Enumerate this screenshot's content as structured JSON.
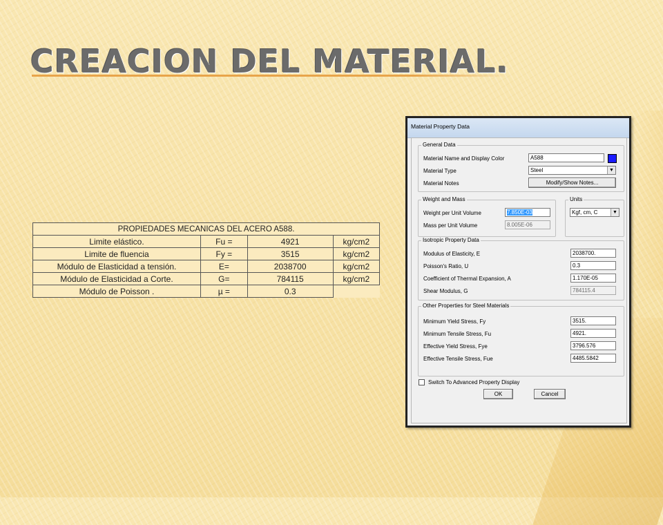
{
  "slide": {
    "title": "CREACION DEL MATERIAL."
  },
  "table": {
    "caption": "PROPIEDADES MECANICAS DEL ACERO A588.",
    "rows": [
      {
        "property": "Limite elástico.",
        "symbol": "Fu  =",
        "value": "4921",
        "unit": "kg/cm2"
      },
      {
        "property": "Limite de fluencia",
        "symbol": "Fy  =",
        "value": "3515",
        "unit": "kg/cm2"
      },
      {
        "property": "Módulo de Elasticidad a tensión.",
        "symbol": "E=",
        "value": "2038700",
        "unit": "kg/cm2"
      },
      {
        "property": "Módulo de Elasticidad a Corte.",
        "symbol": "G=",
        "value": "784115",
        "unit": "kg/cm2"
      },
      {
        "property": "Módulo de Poisson .",
        "symbol": "µ =",
        "value": "0.3",
        "unit": ""
      }
    ]
  },
  "dialog": {
    "title": "Material Property Data",
    "general": {
      "label": "General Data",
      "name_label": "Material Name and Display Color",
      "name_value": "A588",
      "display_color": "#1b1bff",
      "type_label": "Material Type",
      "type_value": "Steel",
      "notes_label": "Material Notes",
      "notes_button": "Modify/Show Notes..."
    },
    "weight": {
      "label": "Weight and Mass",
      "weight_label": "Weight per Unit Volume",
      "weight_value": "7.850E-03",
      "mass_label": "Mass per Unit Volume",
      "mass_value": "8.005E-06"
    },
    "units": {
      "label": "Units",
      "value": "Kgf, cm, C"
    },
    "isotropic": {
      "label": "Isotropic Property Data",
      "rows": [
        {
          "label": "Modulus of Elasticity,  E",
          "value": "2038700."
        },
        {
          "label": "Poisson's Ratio,  U",
          "value": "0.3"
        },
        {
          "label": "Coefficient of Thermal Expansion,  A",
          "value": "1.170E-05"
        },
        {
          "label": "Shear Modulus,  G",
          "value": "784115.4"
        }
      ]
    },
    "steel": {
      "label": "Other Properties for Steel Materials",
      "rows": [
        {
          "label": "Minimum Yield Stress, Fy",
          "value": "3515."
        },
        {
          "label": "Minimum Tensile Stress, Fu",
          "value": "4921."
        },
        {
          "label": "Effective Yield Stress, Fye",
          "value": "3796.576"
        },
        {
          "label": "Effective Tensile Stress, Fue",
          "value": "4485.5842"
        }
      ]
    },
    "advanced_label": "Switch To Advanced Property Display",
    "ok_label": "OK",
    "cancel_label": "Cancel"
  }
}
